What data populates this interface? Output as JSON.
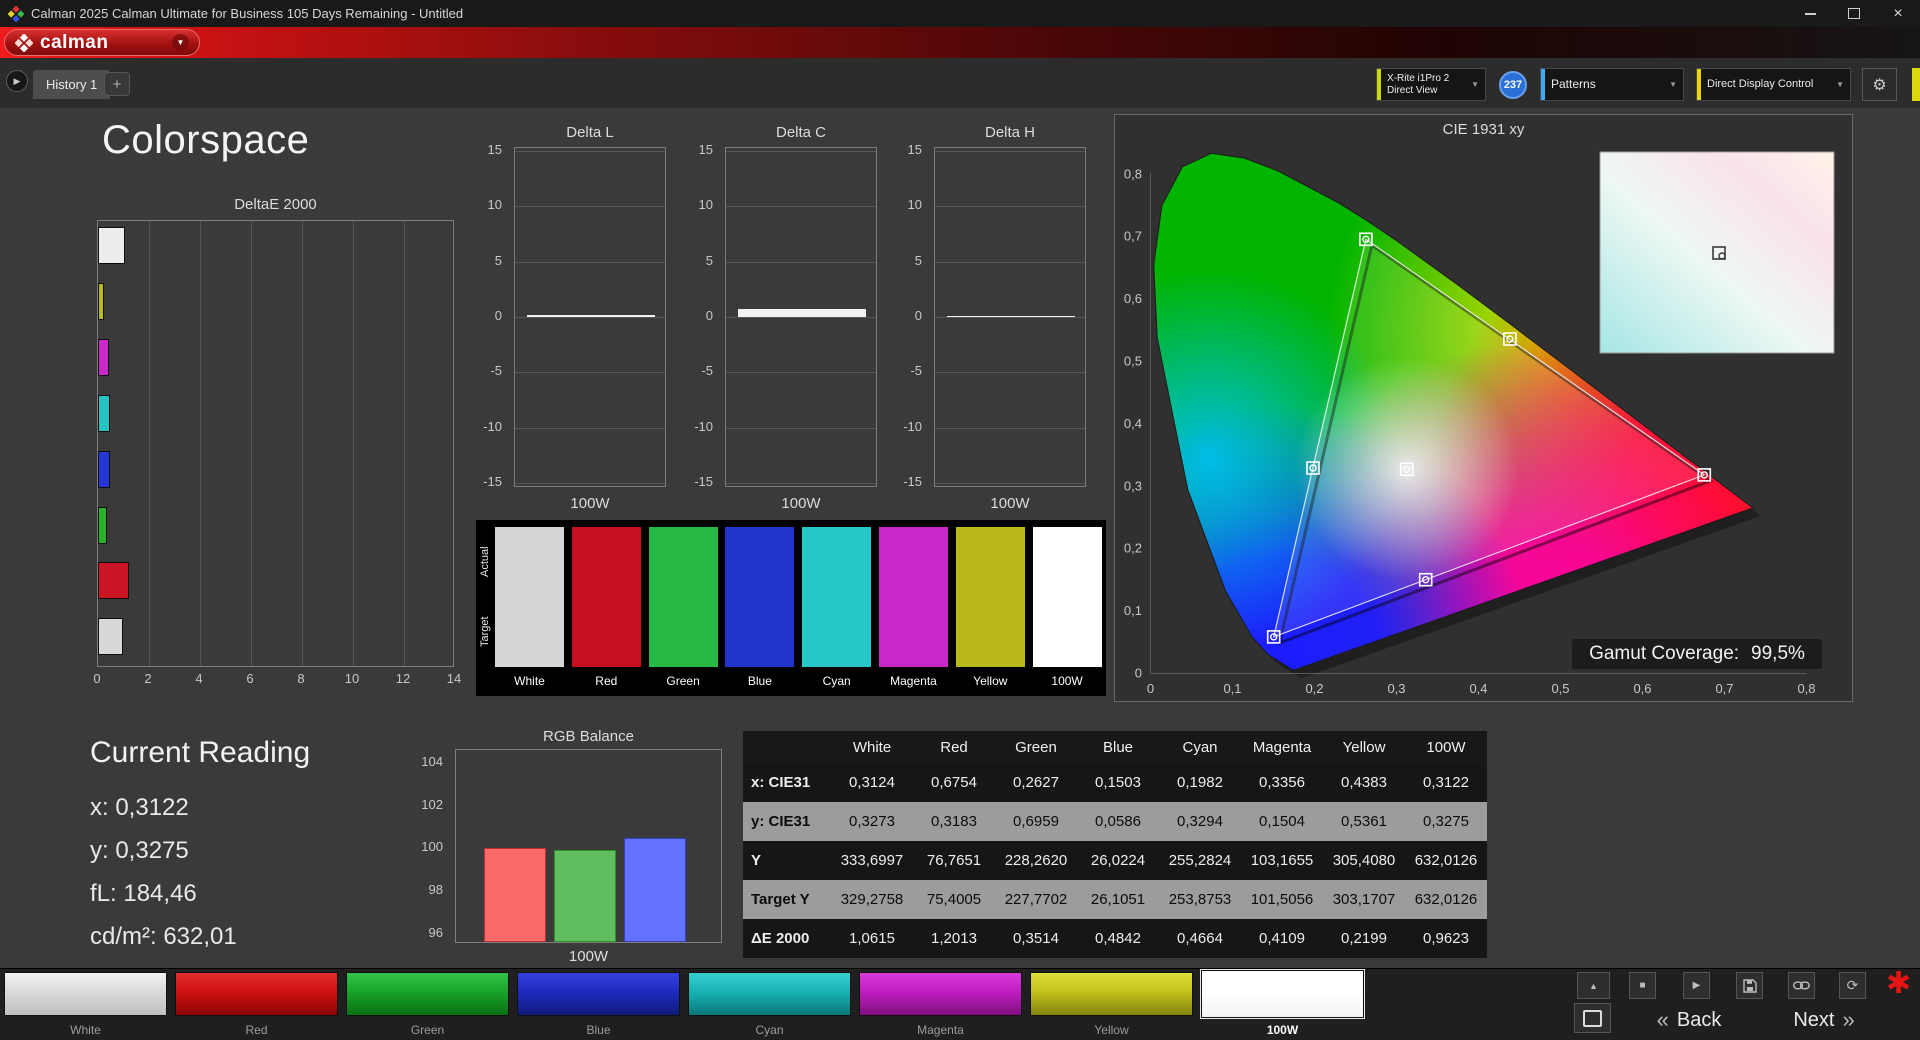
{
  "window": {
    "title": "Calman 2025 Calman Ultimate for Business 105 Days Remaining  - Untitled"
  },
  "brand": {
    "name": "calman"
  },
  "icons": {
    "dropdown_chevron": "▼",
    "tab_prev": "▶",
    "add_tab": "+",
    "gear": "⚙",
    "chevron_up": "▲",
    "stop": "■",
    "play": "▶",
    "refresh": "⟳",
    "asterisk": "✱",
    "back_chevrons": "«",
    "next_chevrons": "»",
    "close": "×"
  },
  "tabbar": {
    "tab": "History 1",
    "meter": {
      "line1": "X-Rite i1Pro 2",
      "line2": "Direct View",
      "accent": "#c8d80a"
    },
    "badge": "237",
    "patterns": {
      "label": "Patterns",
      "accent": "#3fa9f5"
    },
    "display_control": {
      "label": "Direct Display Control",
      "accent": "#e6d800"
    }
  },
  "page": {
    "title": "Colorspace"
  },
  "deltae_chart": {
    "title": "DeltaE 2000",
    "xmax": 14,
    "xticks": [
      "0",
      "2",
      "4",
      "6",
      "8",
      "10",
      "12",
      "14"
    ],
    "bars": [
      {
        "name": "White",
        "color": "#ededed",
        "value": 1.0615
      },
      {
        "name": "Yellow",
        "color": "#b9b920",
        "value": 0.2199
      },
      {
        "name": "Magenta",
        "color": "#cb28cb",
        "value": 0.4109
      },
      {
        "name": "Cyan",
        "color": "#28c2c2",
        "value": 0.4664
      },
      {
        "name": "Blue",
        "color": "#2636d2",
        "value": 0.4842
      },
      {
        "name": "Green",
        "color": "#2ab22a",
        "value": 0.3514
      },
      {
        "name": "Red",
        "color": "#cc1626",
        "value": 1.2013
      },
      {
        "name": "100W",
        "color": "#d8d8d8",
        "value": 0.9623
      }
    ]
  },
  "delta_charts": {
    "yticks": [
      "15",
      "10",
      "5",
      "0",
      "-5",
      "-10",
      "-15"
    ],
    "charts": [
      {
        "title": "Delta L",
        "xlabel": "100W",
        "value": 0.2
      },
      {
        "title": "Delta C",
        "xlabel": "100W",
        "value": 0.75
      },
      {
        "title": "Delta H",
        "xlabel": "100W",
        "value": 0.05
      }
    ]
  },
  "swatch_panel": {
    "row_labels": [
      "Actual",
      "Target"
    ],
    "items": [
      {
        "label": "White",
        "color": "#d6d6d6"
      },
      {
        "label": "Red",
        "color": "#c6101f"
      },
      {
        "label": "Green",
        "color": "#27b845"
      },
      {
        "label": "Blue",
        "color": "#2134cc"
      },
      {
        "label": "Cyan",
        "color": "#28c8c8"
      },
      {
        "label": "Magenta",
        "color": "#c928c9"
      },
      {
        "label": "Yellow",
        "color": "#b9b91d"
      },
      {
        "label": "100W",
        "color": "#ffffff"
      }
    ]
  },
  "cie": {
    "title": "CIE 1931 xy",
    "coverage_label": "Gamut Coverage:",
    "coverage_value": "99,5%",
    "xticks": [
      "0",
      "0,1",
      "0,2",
      "0,3",
      "0,4",
      "0,5",
      "0,6",
      "0,7",
      "0,8"
    ],
    "yticks": [
      "0",
      "0,1",
      "0,2",
      "0,3",
      "0,4",
      "0,5",
      "0,6",
      "0,7",
      "0,8"
    ],
    "triangle": [
      [
        0.6754,
        0.3183
      ],
      [
        0.2627,
        0.6959
      ],
      [
        0.1503,
        0.0586
      ]
    ],
    "points": [
      {
        "name": "white",
        "x": 0.3124,
        "y": 0.3273
      },
      {
        "name": "red",
        "x": 0.6754,
        "y": 0.3183
      },
      {
        "name": "green",
        "x": 0.2627,
        "y": 0.6959
      },
      {
        "name": "blue",
        "x": 0.1503,
        "y": 0.0586
      },
      {
        "name": "cyan",
        "x": 0.1982,
        "y": 0.3294
      },
      {
        "name": "magenta",
        "x": 0.3356,
        "y": 0.1504
      },
      {
        "name": "yellow",
        "x": 0.4383,
        "y": 0.5361
      }
    ]
  },
  "current_reading": {
    "title": "Current Reading",
    "lines": [
      "x: 0,3122",
      "y: 0,3275",
      "fL: 184,46",
      "cd/m²: 632,01"
    ]
  },
  "rgb_balance": {
    "title": "RGB Balance",
    "xlabel": "100W",
    "yticks": [
      "104",
      "102",
      "100",
      "98",
      "96"
    ],
    "ymax": 104.6,
    "ymin": 95.6,
    "bars": [
      {
        "name": "red",
        "value": 100.0,
        "color": "#f96a6a",
        "border": "#c03030"
      },
      {
        "name": "green",
        "value": 99.9,
        "color": "#5fbf5f",
        "border": "#2f8f2f"
      },
      {
        "name": "blue",
        "value": 100.5,
        "color": "#6272ff",
        "border": "#3040c0"
      }
    ]
  },
  "table": {
    "headers": [
      "",
      "White",
      "Red",
      "Green",
      "Blue",
      "Cyan",
      "Magenta",
      "Yellow",
      "100W"
    ],
    "rows": [
      {
        "label": "x: CIE31",
        "shade": "dark",
        "values": [
          "0,3124",
          "0,6754",
          "0,2627",
          "0,1503",
          "0,1982",
          "0,3356",
          "0,4383",
          "0,3122"
        ]
      },
      {
        "label": "y: CIE31",
        "shade": "light",
        "values": [
          "0,3273",
          "0,3183",
          "0,6959",
          "0,0586",
          "0,3294",
          "0,1504",
          "0,5361",
          "0,3275"
        ]
      },
      {
        "label": "Y",
        "shade": "dark",
        "values": [
          "333,6997",
          "76,7651",
          "228,2620",
          "26,0224",
          "255,2824",
          "103,1655",
          "305,4080",
          "632,0126"
        ]
      },
      {
        "label": "Target Y",
        "shade": "light",
        "values": [
          "329,2758",
          "75,4005",
          "227,7702",
          "26,1051",
          "253,8753",
          "101,5056",
          "303,1707",
          "632,0126"
        ]
      },
      {
        "label": "ΔE 2000",
        "shade": "dark",
        "values": [
          "1,0615",
          "1,2013",
          "0,3514",
          "0,4842",
          "0,4664",
          "0,4109",
          "0,2199",
          "0,9623"
        ]
      }
    ]
  },
  "bottom": {
    "buttons": [
      {
        "label": "White",
        "c1": "#f4f4f4",
        "c2": "#dadada",
        "c3": "#c0c0c0",
        "selected": false
      },
      {
        "label": "Red",
        "c1": "#e23030",
        "c2": "#cf1010",
        "c3": "#8a0404",
        "selected": false
      },
      {
        "label": "Green",
        "c1": "#34c34a",
        "c2": "#18a428",
        "c3": "#0b6f14",
        "selected": false
      },
      {
        "label": "Blue",
        "c1": "#3340dc",
        "c2": "#1f2bc0",
        "c3": "#101a78",
        "selected": false
      },
      {
        "label": "Cyan",
        "c1": "#38cfcf",
        "c2": "#17b2b2",
        "c3": "#0b7878",
        "selected": false
      },
      {
        "label": "Magenta",
        "c1": "#d93bd9",
        "c2": "#bf1dbf",
        "c3": "#801080",
        "selected": false
      },
      {
        "label": "Yellow",
        "c1": "#dede3a",
        "c2": "#c2c21c",
        "c3": "#84840e",
        "selected": false
      },
      {
        "label": "100W",
        "c1": "#ffffff",
        "c2": "#ffffff",
        "c3": "#f2f2f2",
        "selected": true
      }
    ],
    "nav": {
      "back": "Back",
      "next": "Next"
    }
  }
}
